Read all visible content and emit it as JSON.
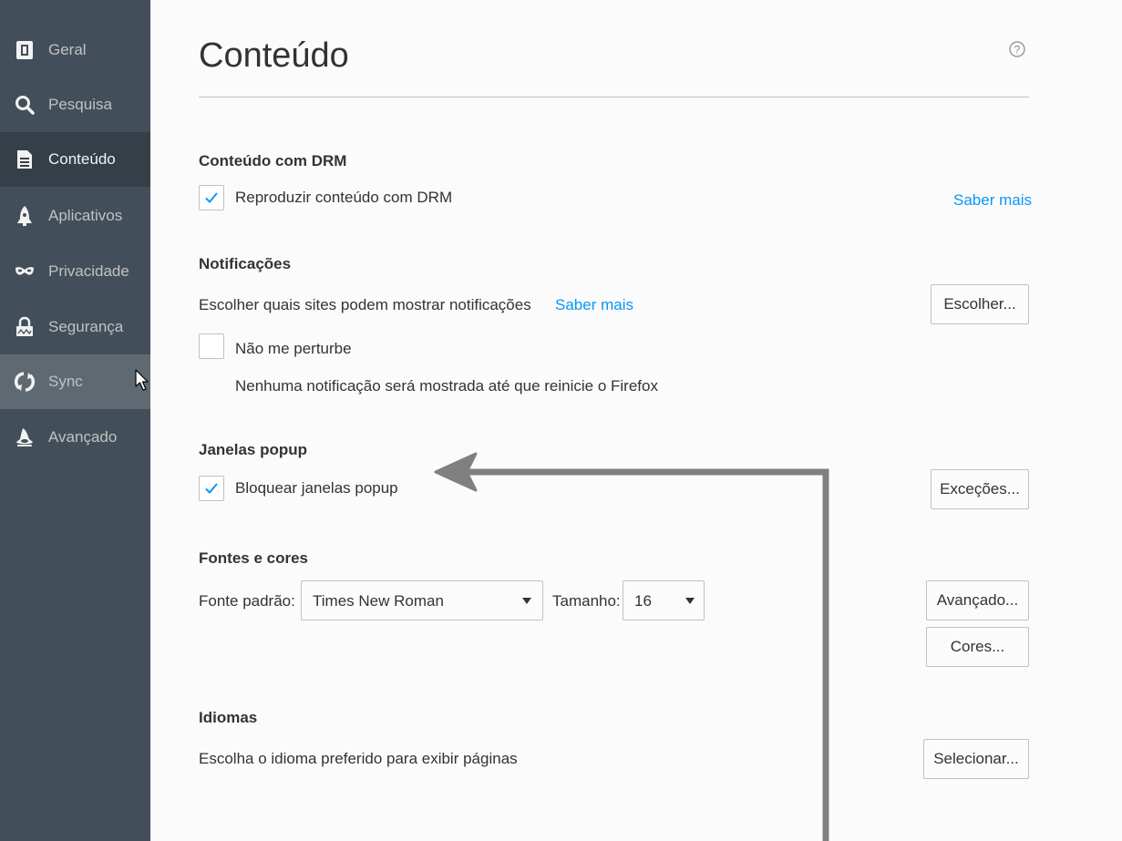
{
  "sidebar": {
    "items": [
      {
        "label": "Geral",
        "icon": "general-icon"
      },
      {
        "label": "Pesquisa",
        "icon": "search-icon"
      },
      {
        "label": "Conteúdo",
        "icon": "document-icon",
        "selected": true
      },
      {
        "label": "Aplicativos",
        "icon": "rocket-icon"
      },
      {
        "label": "Privacidade",
        "icon": "mask-icon"
      },
      {
        "label": "Segurança",
        "icon": "lock-icon"
      },
      {
        "label": "Sync",
        "icon": "sync-icon",
        "hovered": true
      },
      {
        "label": "Avançado",
        "icon": "wizard-hat-icon"
      }
    ]
  },
  "page": {
    "title": "Conteúdo",
    "help_icon": "question-circle-icon"
  },
  "drm": {
    "title": "Conteúdo com DRM",
    "checkbox_label": "Reproduzir conteúdo com DRM",
    "checked": true,
    "learn_more": "Saber mais"
  },
  "notifications": {
    "title": "Notificações",
    "description": "Escolher quais sites podem mostrar notificações",
    "learn_more": "Saber mais",
    "choose_button": "Escolher...",
    "dnd_label": "Não me perturbe",
    "dnd_checked": false,
    "dnd_note": "Nenhuma notificação será mostrada até que reinicie o Firefox"
  },
  "popups": {
    "title": "Janelas popup",
    "checkbox_label": "Bloquear janelas popup",
    "checked": true,
    "exceptions_button": "Exceções..."
  },
  "fonts": {
    "title": "Fontes e cores",
    "default_font_label": "Fonte padrão:",
    "default_font_value": "Times New Roman",
    "size_label": "Tamanho:",
    "size_value": "16",
    "advanced_button": "Avançado...",
    "colors_button": "Cores..."
  },
  "languages": {
    "title": "Idiomas",
    "description": "Escolha o idioma preferido para exibir páginas",
    "select_button": "Selecionar..."
  },
  "colors": {
    "sidebar_bg": "#424f5a",
    "sidebar_selected": "#343f48",
    "sidebar_hover": "#5e6972",
    "link": "#0996f8",
    "annotation_arrow": "#808080"
  }
}
